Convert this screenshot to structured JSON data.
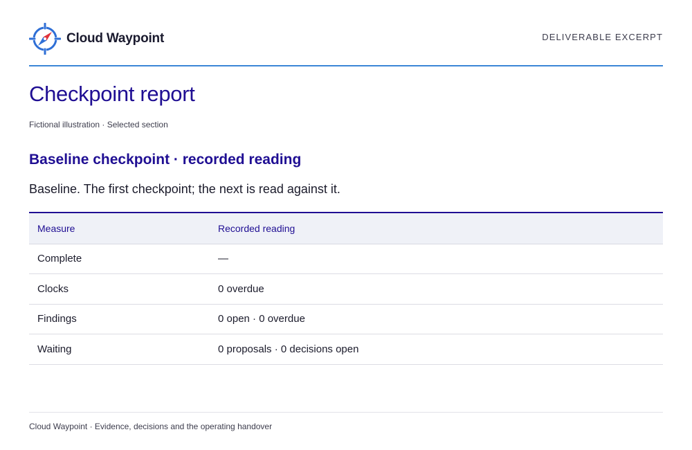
{
  "header": {
    "brand_name": "Cloud Waypoint",
    "logo_icon": "compass-icon",
    "document_type": "DELIVERABLE EXCERPT"
  },
  "page": {
    "title": "Checkpoint report",
    "subtitle": "Fictional illustration · Selected section"
  },
  "section": {
    "heading": "Baseline checkpoint · recorded reading",
    "lead": "Baseline. The first checkpoint; the next is read against it."
  },
  "table": {
    "columns": [
      "Measure",
      "Recorded reading"
    ],
    "rows": [
      [
        "Complete",
        "—"
      ],
      [
        "Clocks",
        "0 overdue"
      ],
      [
        "Findings",
        "0 open · 0 overdue"
      ],
      [
        "Waiting",
        "0 proposals · 0 decisions open"
      ]
    ]
  },
  "footer": {
    "text": "Cloud Waypoint · Evidence, decisions and the operating handover"
  },
  "colors": {
    "accent": "#1f0e93",
    "rule": "#3b86d6",
    "logo_blue": "#2f6fd6",
    "logo_red": "#e0333c"
  }
}
